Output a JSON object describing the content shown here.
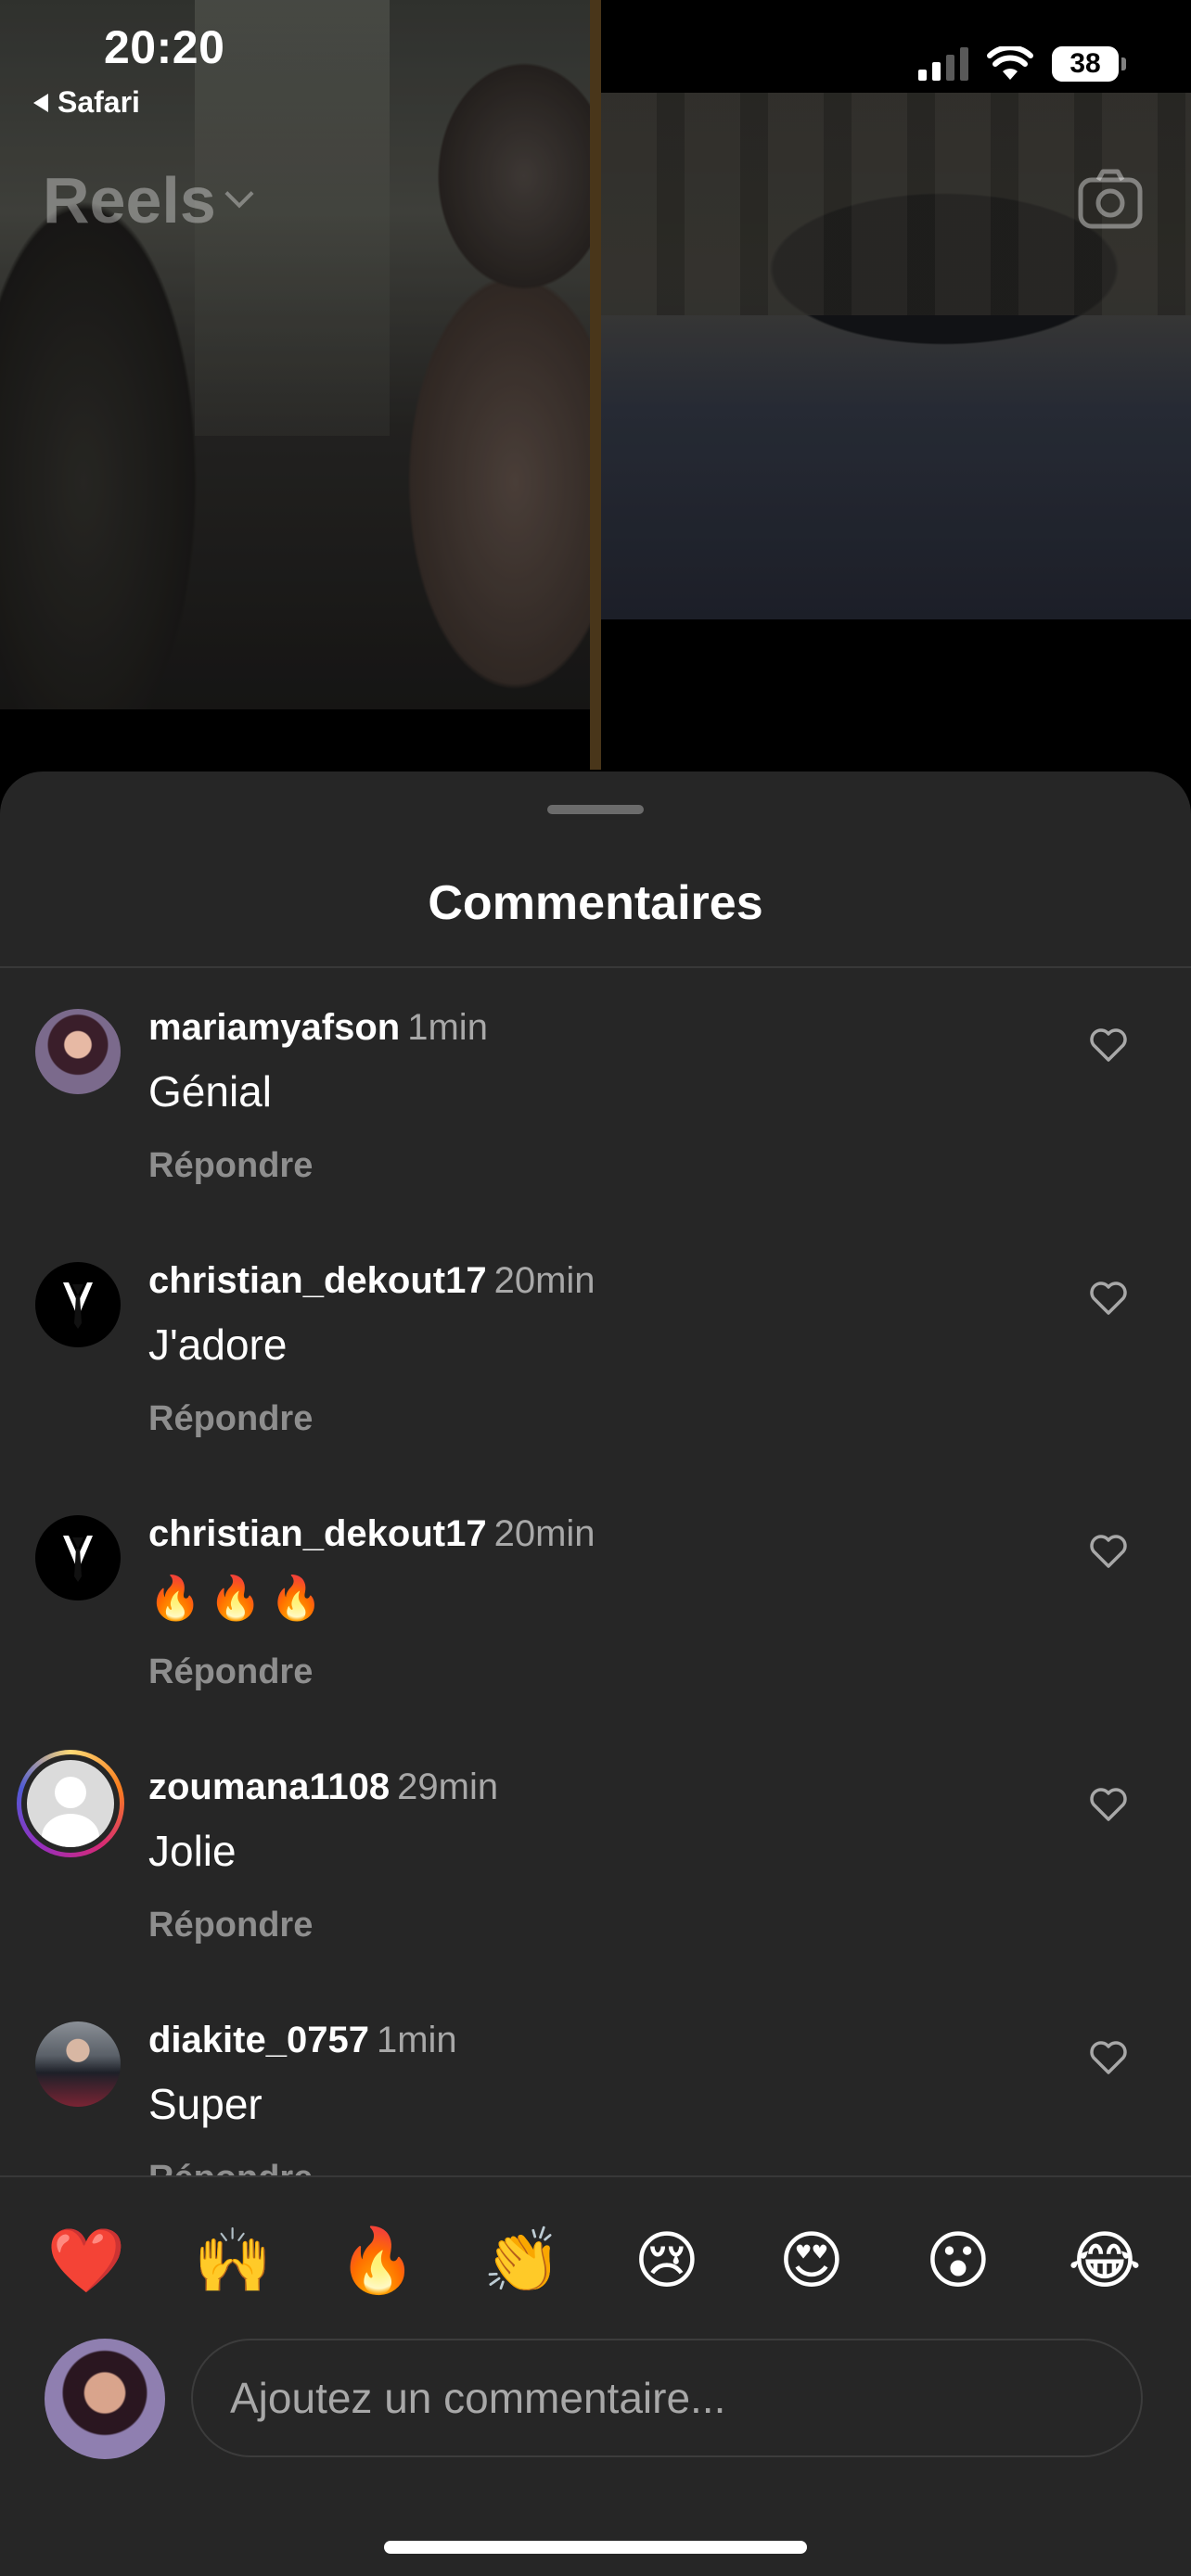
{
  "status_bar": {
    "time": "20:20",
    "back_app": "Safari",
    "battery": "38",
    "signal_icon": "cellular-signal-icon",
    "wifi_icon": "wifi-icon"
  },
  "header": {
    "title": "Reels",
    "dropdown_icon": "chevron-down-icon",
    "camera_icon": "camera-icon"
  },
  "sheet": {
    "title": "Commentaires",
    "comments": [
      {
        "username": "mariamyafson",
        "time": "1min",
        "text": "Génial",
        "reply_label": "Répondre"
      },
      {
        "username": "christian_dekout17",
        "time": "20min",
        "text": "J'adore",
        "reply_label": "Répondre"
      },
      {
        "username": "christian_dekout17",
        "time": "20min",
        "text": "🔥🔥🔥",
        "reply_label": "Répondre"
      },
      {
        "username": "zoumana1108",
        "time": "29min",
        "text": "Jolie",
        "reply_label": "Répondre"
      },
      {
        "username": "diakite_0757",
        "time": "1min",
        "text": "Super",
        "reply_label": "Répondre"
      }
    ],
    "quick_reactions": [
      "❤️",
      "🙌",
      "🔥",
      "👏",
      "😢",
      "😍",
      "😮",
      "😂"
    ],
    "input": {
      "placeholder": "Ajoutez un commentaire..."
    }
  }
}
